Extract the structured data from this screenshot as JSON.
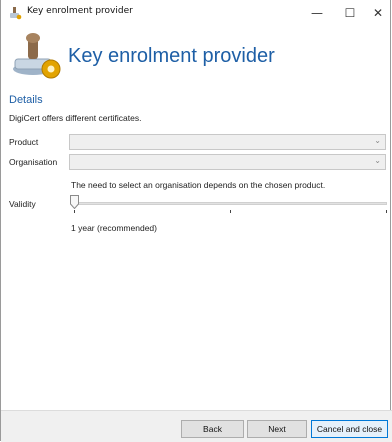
{
  "window": {
    "title": "Key enrolment provider",
    "controls": {
      "minimize": "—",
      "maximize": "☐",
      "close": "✕"
    }
  },
  "header": {
    "title": "Key enrolment provider",
    "icon": "certificate-stamp-gear-icon"
  },
  "details": {
    "section_title": "Details",
    "description": "DigiCert offers different certificates.",
    "product": {
      "label": "Product",
      "value": ""
    },
    "organisation": {
      "label": "Organisation",
      "value": ""
    },
    "organisation_hint": "The need to select an organisation depends on the chosen product.",
    "validity": {
      "label": "Validity",
      "value_text": "1 year (recommended)",
      "level": 0
    }
  },
  "footer": {
    "back_label": "Back",
    "next_label": "Next",
    "cancel_label": "Cancel and close"
  }
}
